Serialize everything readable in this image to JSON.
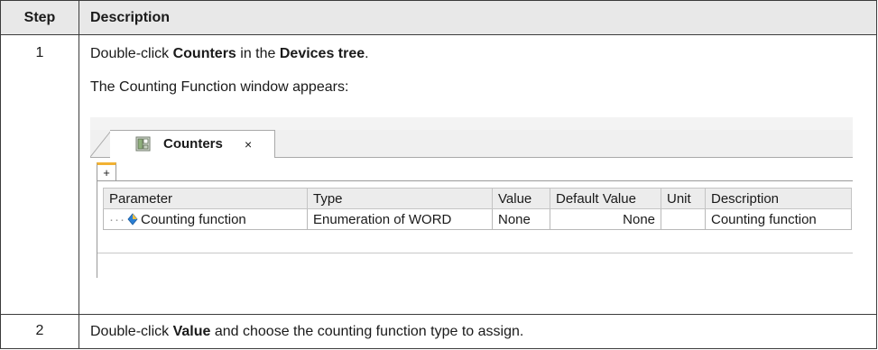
{
  "table": {
    "headers": {
      "step": "Step",
      "description": "Description"
    },
    "rows": [
      {
        "step": "1",
        "line1": {
          "pre": "Double-click ",
          "bold1": "Counters",
          "mid": " in the ",
          "bold2": "Devices tree",
          "post": "."
        },
        "line2": "The Counting Function window appears:"
      },
      {
        "step": "2",
        "line1": {
          "pre": "Double-click ",
          "bold1": "Value",
          "post": " and choose the counting function type to assign."
        }
      }
    ]
  },
  "screenshot": {
    "tab_label": "Counters",
    "tab_close": "×",
    "add_tab": "+",
    "icons": {
      "tab": "counter-module-icon",
      "param": "blue-diamond-parameter-icon"
    },
    "grid": {
      "columns": [
        "Parameter",
        "Type",
        "Value",
        "Default Value",
        "Unit",
        "Description"
      ],
      "rows": [
        {
          "tree_prefix": "···",
          "parameter": "Counting function",
          "type": "Enumeration of WORD",
          "value": "None",
          "default_value": "None",
          "unit": "",
          "description": "Counting function"
        }
      ]
    },
    "colors": {
      "active_tab_accent": "#f2b233",
      "param_icon": "#2a7fd4"
    }
  }
}
